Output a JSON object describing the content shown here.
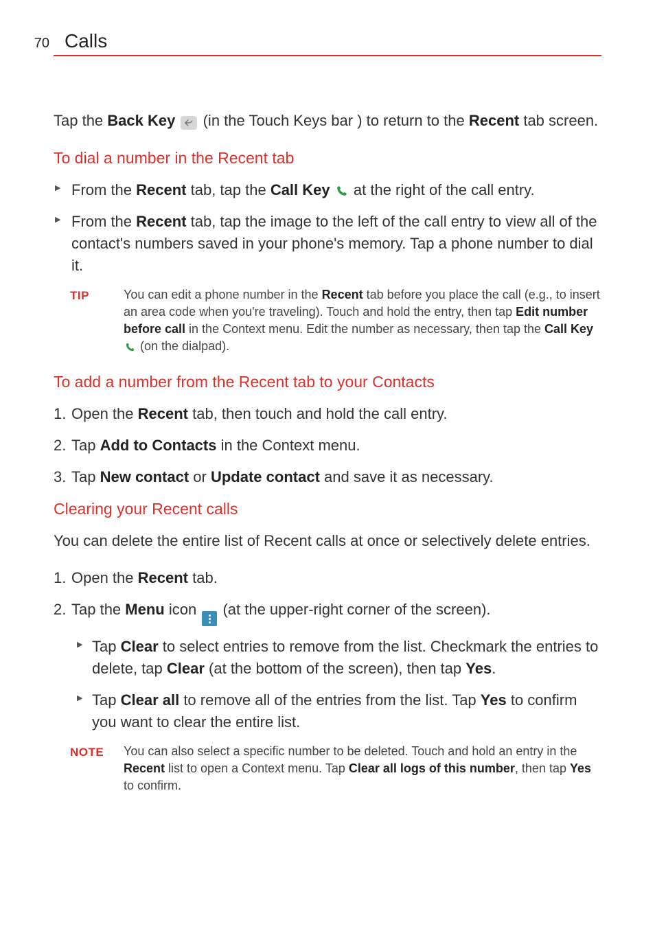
{
  "header": {
    "page_number": "70",
    "title": "Calls"
  },
  "intro": {
    "pre": "Tap the ",
    "back_key": "Back Key",
    "mid": " (in the Touch Keys bar ) to return to the ",
    "recent": "Recent",
    "post": " tab screen."
  },
  "section1": {
    "heading": "To dial a number in the Recent tab",
    "bullets": [
      {
        "p1": "From the ",
        "b1": "Recent",
        "p2": " tab, tap the ",
        "b2": "Call Key",
        "p3": " at the right of the call entry."
      },
      {
        "p1": "From the ",
        "b1": "Recent",
        "p2": " tab, tap the image to the left of the call entry to view all of the contact's numbers saved in your phone's memory. Tap a phone number to dial it."
      }
    ],
    "tip": {
      "label": "TIP",
      "p1": "You can edit a phone number in the ",
      "b1": "Recent",
      "p2": " tab before you place the call (e.g., to insert an area code when you're traveling). Touch and hold the entry, then tap ",
      "b2": "Edit number before call",
      "p3": " in the Context menu. Edit the number as necessary, then tap the ",
      "b3": "Call Key",
      "p4": " (on the dialpad)."
    }
  },
  "section2": {
    "heading": "To add a number from the Recent tab to your Contacts",
    "steps": [
      {
        "p1": "Open the ",
        "b1": "Recent",
        "p2": " tab, then touch and hold the call entry."
      },
      {
        "p1": "Tap ",
        "b1": "Add to Contacts",
        "p2": " in the Context menu."
      },
      {
        "p1": "Tap ",
        "b1": "New contact",
        "p2": " or ",
        "b2": "Update contact",
        "p3": " and save it as necessary."
      }
    ]
  },
  "section3": {
    "heading": "Clearing your Recent calls",
    "intro": "You can delete the entire list of Recent calls at once or selectively delete entries.",
    "steps": [
      {
        "p1": "Open the ",
        "b1": "Recent",
        "p2": " tab."
      },
      {
        "p1": "Tap the ",
        "b1": "Menu",
        "p2": " icon ",
        "p3": " (at the upper-right corner of the screen)."
      }
    ],
    "subbullets": [
      {
        "p1": "Tap ",
        "b1": "Clear",
        "p2": " to select entries to remove from the list. Checkmark the entries to delete, tap ",
        "b2": "Clear",
        "p3": " (at the bottom of the screen), then tap ",
        "b3": "Yes",
        "p4": "."
      },
      {
        "p1": "Tap ",
        "b1": "Clear all",
        "p2": " to remove all of the entries from the list. Tap ",
        "b2": "Yes",
        "p3": " to confirm you want to clear the entire list."
      }
    ],
    "note": {
      "label": "NOTE",
      "p1": "You can also select a specific number to be deleted. Touch and hold an entry in the ",
      "b1": "Recent",
      "p2": " list to open a Context menu. Tap ",
      "b2": "Clear all logs of this number",
      "p3": ", then tap ",
      "b3": "Yes",
      "p4": " to confirm."
    }
  }
}
